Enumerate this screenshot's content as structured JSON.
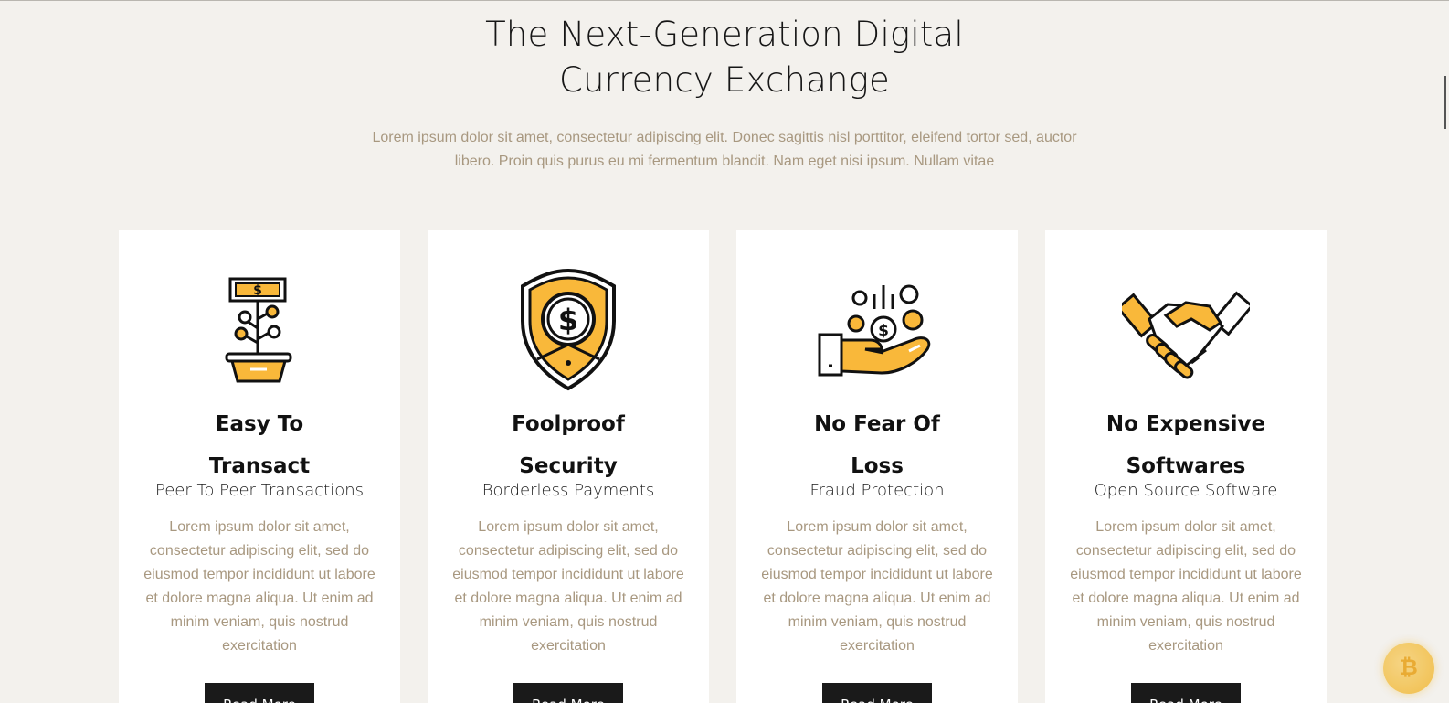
{
  "hero": {
    "title_line1": "The Next-Generation Digital",
    "title_line2": "Currency Exchange",
    "description": "Lorem ipsum dolor sit amet, consectetur adipiscing elit. Donec sagittis nisl porttitor, eleifend tortor sed, auctor libero. Proin quis purus eu mi fermentum blandit. Nam eget nisi ipsum. Nullam vitae"
  },
  "cards": [
    {
      "icon": "money-plant-icon",
      "title": "Easy To Transact",
      "subtitle": "Peer To Peer Transactions",
      "text": "Lorem ipsum dolor sit amet, consectetur adipiscing elit, sed do eiusmod tempor incididunt ut labore et dolore magna aliqua. Ut enim ad minim veniam, quis nostrud exercitation",
      "button": "Read More"
    },
    {
      "icon": "shield-dollar-icon",
      "title": "Foolproof Security",
      "subtitle": "Borderless Payments",
      "text": "Lorem ipsum dolor sit amet, consectetur adipiscing elit, sed do eiusmod tempor incididunt ut labore et dolore magna aliqua. Ut enim ad minim veniam, quis nostrud exercitation",
      "button": "Read More"
    },
    {
      "icon": "hand-coins-icon",
      "title": "No Fear Of Loss",
      "subtitle": "Fraud Protection",
      "text": "Lorem ipsum dolor sit amet, consectetur adipiscing elit, sed do eiusmod tempor incididunt ut labore et dolore magna aliqua. Ut enim ad minim veniam, quis nostrud exercitation",
      "button": "Read More"
    },
    {
      "icon": "handshake-icon",
      "title": "No Expensive Softwares",
      "subtitle": "Open Source Software",
      "text": "Lorem ipsum dolor sit amet, consectetur adipiscing elit, sed do eiusmod tempor incididunt ut labore et dolore magna aliqua. Ut enim ad minim veniam, quis nostrud exercitation",
      "button": "Read More"
    }
  ],
  "colors": {
    "accent": "#f9b83a",
    "background": "#f3f1ed",
    "button": "#1a1a1a",
    "muted_text": "#a89880"
  },
  "floating_button": {
    "icon": "bitcoin-icon"
  }
}
